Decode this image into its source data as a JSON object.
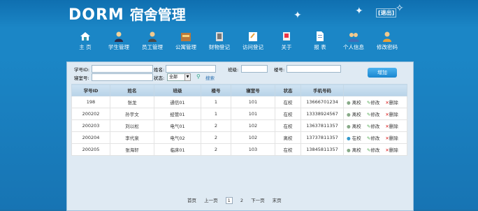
{
  "header": {
    "brand_en": "DORM",
    "brand_zh": "宿舍管理",
    "user_chip": "[退出]"
  },
  "nav": [
    {
      "label": "主 页",
      "icon": "home-icon"
    },
    {
      "label": "学生管理",
      "icon": "student-icon"
    },
    {
      "label": "员工管理",
      "icon": "staff-icon"
    },
    {
      "label": "公寓管理",
      "icon": "apartment-icon"
    },
    {
      "label": "财物登记",
      "icon": "property-icon"
    },
    {
      "label": "访问登记",
      "icon": "visit-icon"
    },
    {
      "label": "关于",
      "icon": "about-icon"
    },
    {
      "label": "报 表",
      "icon": "report-icon"
    },
    {
      "label": "个人信息",
      "icon": "profile-icon"
    },
    {
      "label": "修改密码",
      "icon": "password-icon"
    }
  ],
  "filters": {
    "student_id_label": "学号ID:",
    "dorm_label": "寝室号:",
    "name_label": "姓名:",
    "status_label": "状态:",
    "status_value": "全部",
    "class_label": "班级:",
    "building_label": "楼号:",
    "search_label": "搜索",
    "query_button": "增加"
  },
  "table": {
    "headers": [
      "学号ID",
      "姓名",
      "班级",
      "楼号",
      "寝室号",
      "状态",
      "手机号码",
      ""
    ],
    "rows": [
      {
        "id": "198",
        "name": "张龙",
        "class": "通信01",
        "building": "1",
        "room": "101",
        "status": "在校",
        "phone": "13666701234",
        "toggle": "离校"
      },
      {
        "id": "200202",
        "name": "孙宇文",
        "class": "经管01",
        "building": "1",
        "room": "101",
        "status": "在校",
        "phone": "13338924567",
        "toggle": "离校"
      },
      {
        "id": "200203",
        "name": "刘以松",
        "class": "电气01",
        "building": "2",
        "room": "102",
        "status": "在校",
        "phone": "13637811357",
        "toggle": "离校"
      },
      {
        "id": "200204",
        "name": "李代泉",
        "class": "电气02",
        "building": "2",
        "room": "102",
        "status": "离校",
        "phone": "13737811357",
        "toggle": "在校"
      },
      {
        "id": "200205",
        "name": "张海轩",
        "class": "临床01",
        "building": "2",
        "room": "103",
        "status": "在校",
        "phone": "13845811357",
        "toggle": "离校"
      }
    ],
    "edit_label": "修改",
    "delete_label": "删除"
  },
  "pager": {
    "first": "首页",
    "prev": "上一页",
    "page1": "1",
    "page2": "2",
    "next": "下一页",
    "last": "末页"
  }
}
